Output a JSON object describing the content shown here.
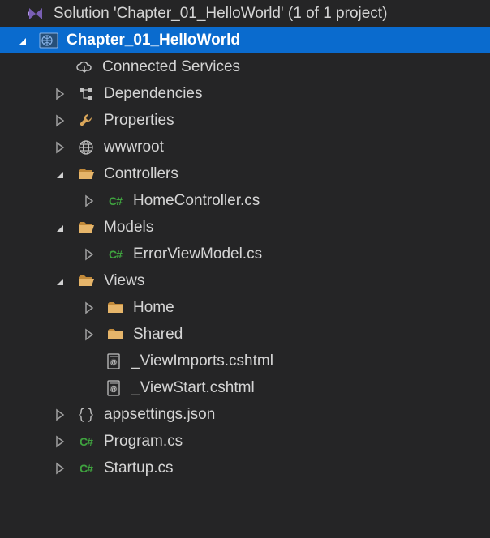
{
  "solution": {
    "label": "Solution 'Chapter_01_HelloWorld' (1 of 1 project)"
  },
  "project": {
    "label": "Chapter_01_HelloWorld"
  },
  "items": {
    "connectedServices": "Connected Services",
    "dependencies": "Dependencies",
    "properties": "Properties",
    "wwwroot": "wwwroot",
    "controllers": "Controllers",
    "homeController": "HomeController.cs",
    "models": "Models",
    "errorViewModel": "ErrorViewModel.cs",
    "views": "Views",
    "home": "Home",
    "shared": "Shared",
    "viewImports": "_ViewImports.cshtml",
    "viewStart": "_ViewStart.cshtml",
    "appsettings": "appsettings.json",
    "program": "Program.cs",
    "startup": "Startup.cs"
  },
  "csharpBadge": "C#"
}
